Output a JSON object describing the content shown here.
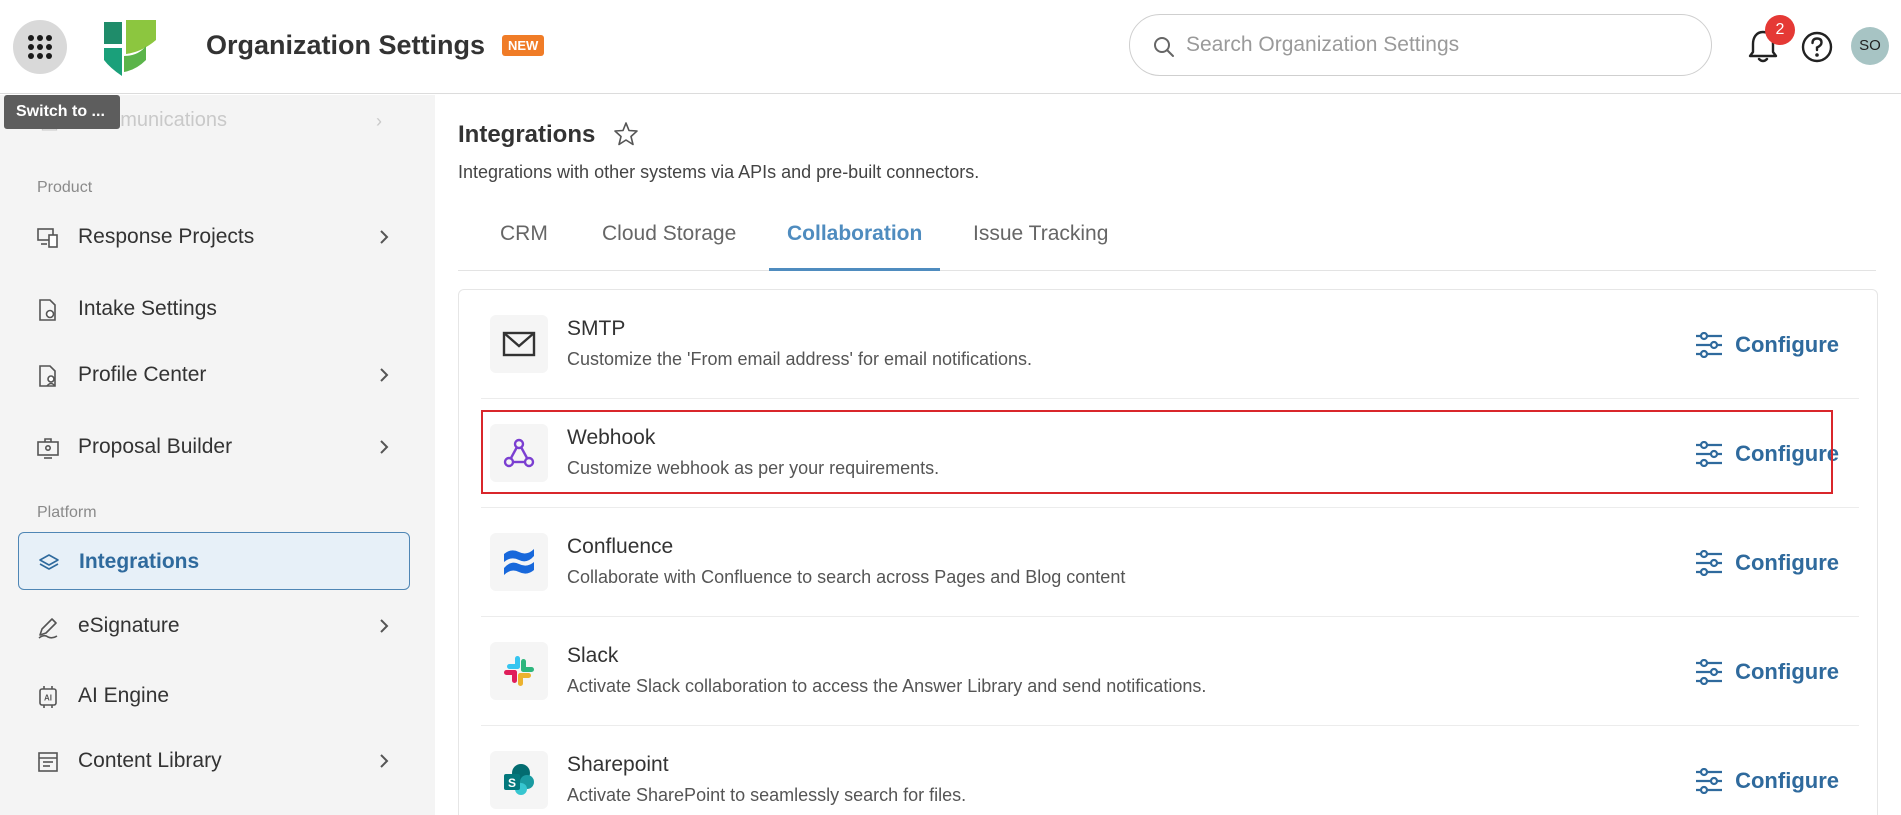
{
  "header": {
    "title": "Organization Settings",
    "badge": "NEW",
    "search_placeholder": "Search Organization Settings",
    "notification_count": "2",
    "avatar_initials": "SO"
  },
  "tooltip": "Switch to ...",
  "sidebar": {
    "ghost_item": "Communications",
    "sections": [
      {
        "label": "Product"
      },
      {
        "label": "Platform"
      }
    ],
    "items": [
      {
        "label": "Response Projects",
        "icon": "response-projects-icon",
        "has_chevron": true
      },
      {
        "label": "Intake Settings",
        "icon": "intake-settings-icon",
        "has_chevron": false
      },
      {
        "label": "Profile Center",
        "icon": "profile-center-icon",
        "has_chevron": true
      },
      {
        "label": "Proposal Builder",
        "icon": "proposal-builder-icon",
        "has_chevron": true
      },
      {
        "label": "Integrations",
        "icon": "layers-icon",
        "has_chevron": false,
        "active": true
      },
      {
        "label": "eSignature",
        "icon": "signature-icon",
        "has_chevron": true
      },
      {
        "label": "AI Engine",
        "icon": "ai-chip-icon",
        "has_chevron": false
      },
      {
        "label": "Content Library",
        "icon": "content-library-icon",
        "has_chevron": true
      }
    ]
  },
  "main": {
    "title": "Integrations",
    "subtitle": "Integrations with other systems via APIs and pre-built connectors.",
    "tabs": [
      {
        "label": "CRM"
      },
      {
        "label": "Cloud Storage"
      },
      {
        "label": "Collaboration",
        "active": true
      },
      {
        "label": "Issue Tracking"
      }
    ],
    "integrations": [
      {
        "name": "SMTP",
        "description": "Customize the 'From email address' for email notifications.",
        "action": "Configure",
        "icon": "mail-icon"
      },
      {
        "name": "Webhook",
        "description": "Customize webhook as per your requirements.",
        "action": "Configure",
        "icon": "webhook-icon"
      },
      {
        "name": "Confluence",
        "description": "Collaborate with Confluence to search across Pages and Blog content",
        "action": "Configure",
        "icon": "confluence-icon"
      },
      {
        "name": "Slack",
        "description": "Activate Slack collaboration to access the Answer Library and send notifications.",
        "action": "Configure",
        "icon": "slack-icon"
      },
      {
        "name": "Sharepoint",
        "description": "Activate SharePoint to seamlessly search for files.",
        "action": "Configure",
        "icon": "sharepoint-icon"
      }
    ]
  },
  "colors": {
    "accent": "#2f6a9d",
    "tab_active": "#4f8cbf",
    "badge": "#f07c27",
    "notification": "#e53935",
    "highlight": "#d9262b"
  }
}
